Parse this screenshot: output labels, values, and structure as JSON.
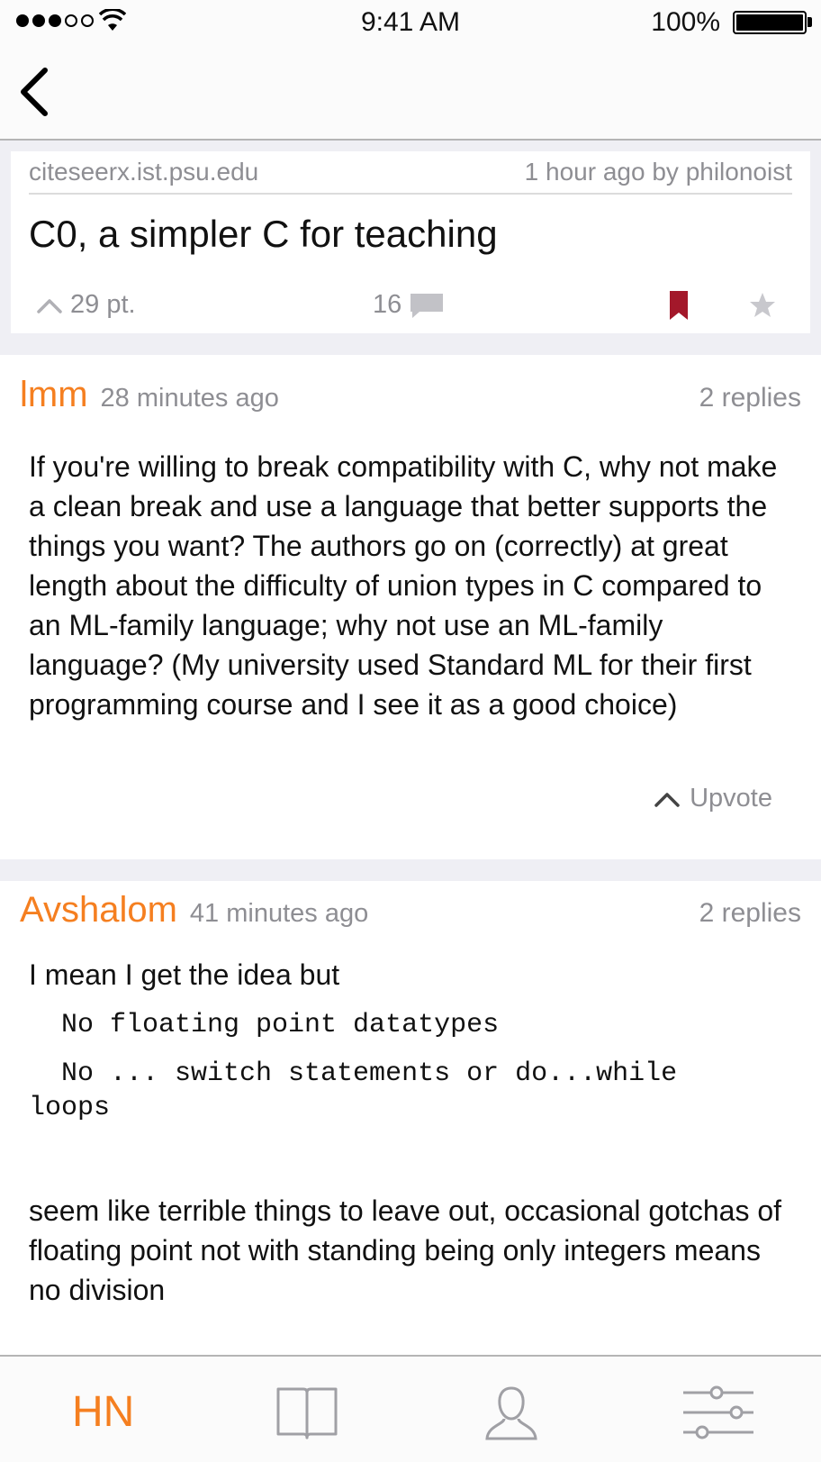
{
  "status_bar": {
    "time": "9:41 AM",
    "battery": "100%"
  },
  "story": {
    "domain": "citeseerx.ist.psu.edu",
    "posted": "1 hour ago by philonoist",
    "title": "C0, a simpler C for teaching",
    "points": "29 pt.",
    "comments": "16",
    "bookmark_color": "#a3182a"
  },
  "comments": [
    {
      "author": "lmm",
      "time": "28 minutes ago",
      "replies": "2 replies",
      "body": "If you're willing to break compatibility with C, why not make a clean break and use a language that better supports the things you want? The authors go on (correctly) at great length about the difficulty of union types in C compared to an ML-family language; why not use an ML-family language? (My university used Standard ML for their first programming course and I see it as a good choice)",
      "upvote": "Upvote"
    },
    {
      "author": "Avshalom",
      "time": "41 minutes ago",
      "replies": "2 replies",
      "intro": "I mean I get the idea but",
      "code_line_1": "  No floating point datatypes",
      "code_line_2": "  No ... switch statements or do...while",
      "code_line_3": "loops",
      "body_after": "seem like terrible things to leave out, occasional gotchas of floating point not with standing being only integers means no division"
    }
  ],
  "tab_bar": {
    "hn_label": "HN",
    "accent_color": "#f57f20"
  }
}
